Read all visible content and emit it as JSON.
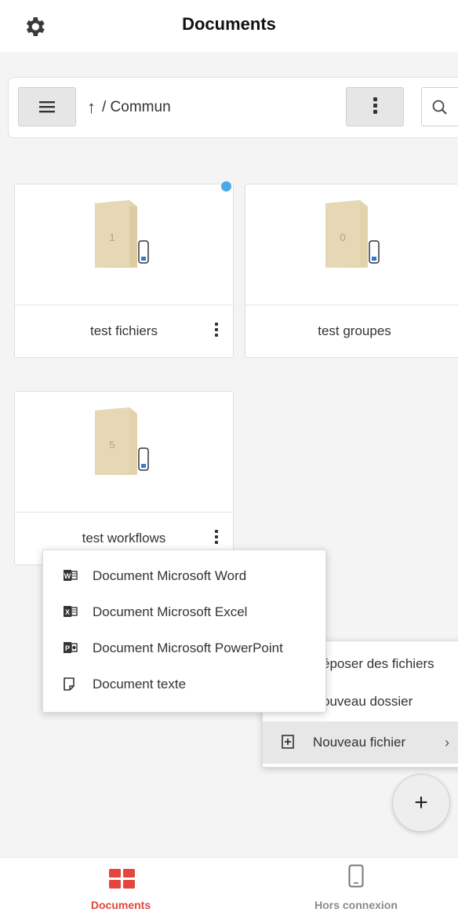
{
  "header": {
    "title": "Documents",
    "settings_icon": "gear-icon"
  },
  "toolbar": {
    "menu_icon": "hamburger-icon",
    "up_glyph": "↑",
    "path": "/ Commun",
    "more_icon": "kebab-icon",
    "search_icon": "search-icon"
  },
  "folders": [
    {
      "name": "test fichiers",
      "count": "1",
      "has_notification": true
    },
    {
      "name": "test groupes",
      "count": "0",
      "has_notification": false
    },
    {
      "name": "test workflows",
      "count": "5",
      "has_notification": false
    }
  ],
  "context_menu": {
    "items": [
      {
        "label": "époser des fichiers"
      },
      {
        "label": "ouveau dossier"
      },
      {
        "label": "Nouveau fichier",
        "chevron": "›",
        "icon": "new-file-icon"
      }
    ]
  },
  "new_file_submenu": {
    "items": [
      {
        "label": "Document Microsoft Word",
        "icon": "word-icon"
      },
      {
        "label": "Document Microsoft Excel",
        "icon": "excel-icon"
      },
      {
        "label": "Document Microsoft PowerPoint",
        "icon": "powerpoint-icon"
      },
      {
        "label": "Document texte",
        "icon": "text-document-icon"
      }
    ]
  },
  "fab": {
    "glyph": "+"
  },
  "bottom_nav": {
    "tabs": [
      {
        "label": "Documents",
        "icon": "grid-icon",
        "active": true
      },
      {
        "label": "Hors connexion",
        "icon": "phone-icon",
        "active": false
      }
    ]
  },
  "colors": {
    "accent": "#e2463f",
    "notification": "#4aaae8",
    "folder": "#e2d3ad",
    "folder_dark": "#d4c192"
  }
}
